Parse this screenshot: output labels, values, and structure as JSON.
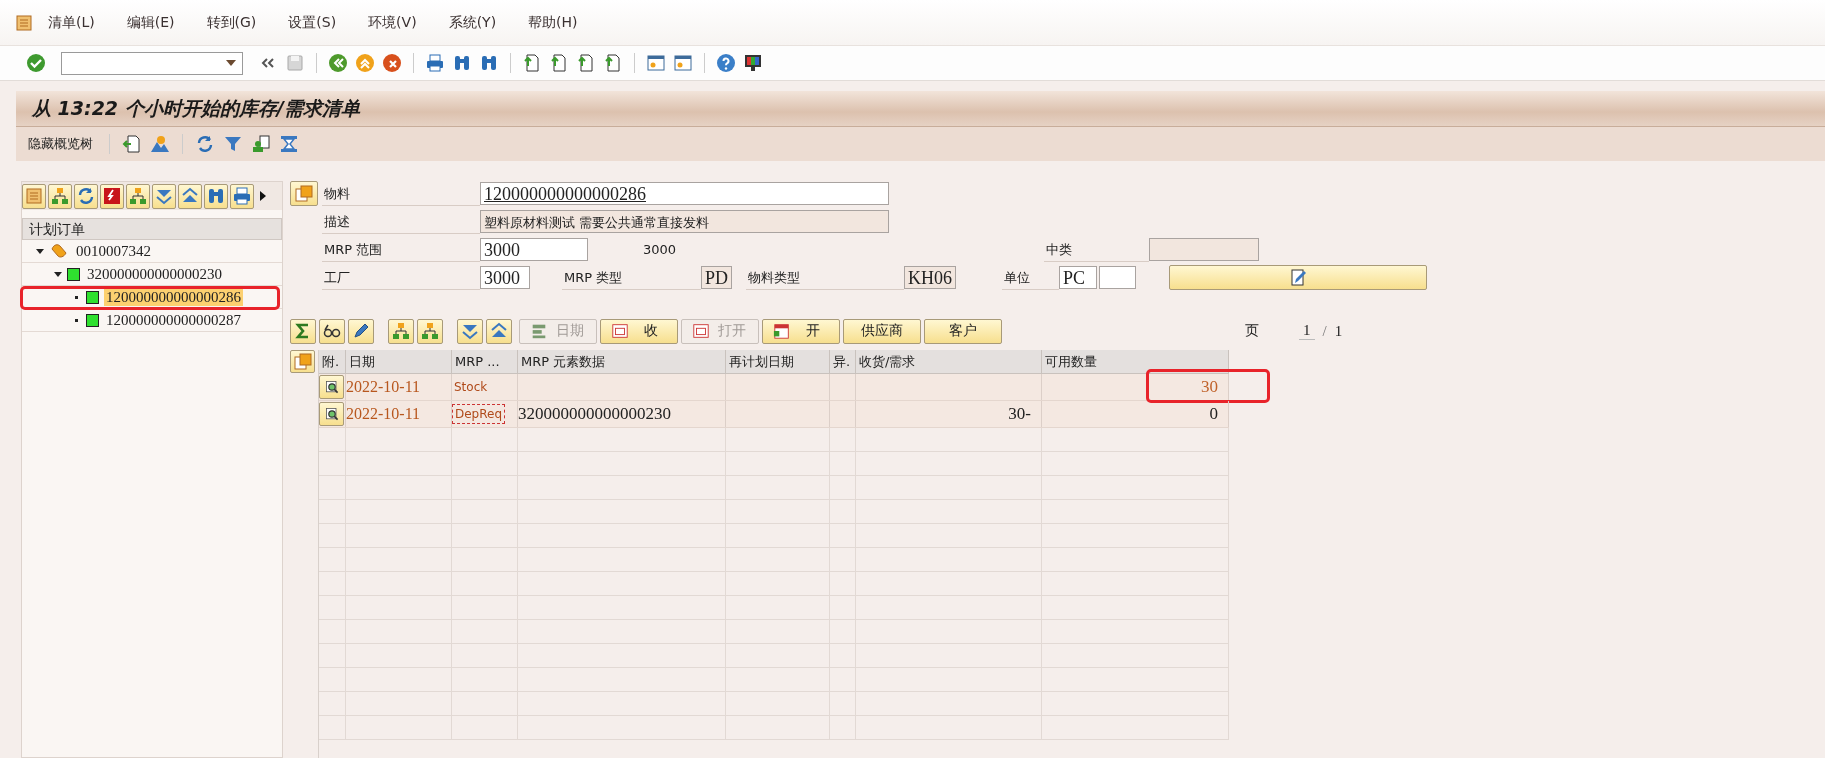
{
  "menu_bar": {
    "items": [
      "清单(L)",
      "编辑(E)",
      "转到(G)",
      "设置(S)",
      "环境(V)",
      "系统(Y)",
      "帮助(H)"
    ]
  },
  "title": "从 13:22 个小时开始的库存/需求清单",
  "hide_tree_button": "隐藏概览树",
  "tree": {
    "header": "计划订单",
    "items": [
      {
        "label": "0010007342",
        "kind": "folder",
        "expanded": true,
        "selected": false,
        "highlighted": false,
        "children": [
          {
            "label": "320000000000000230",
            "kind": "order",
            "expanded": true,
            "selected": false,
            "highlighted": false,
            "children": [
              {
                "label": "120000000000000286",
                "kind": "order",
                "selected": true,
                "highlighted": true
              },
              {
                "label": "120000000000000287",
                "kind": "order",
                "selected": false,
                "highlighted": false
              }
            ]
          }
        ]
      }
    ]
  },
  "header": {
    "material_label": "物料",
    "material": "120000000000000286",
    "description_label": "描述",
    "description": "塑料原材料测试  需要公共通常直接发料",
    "mrp_area_label": "MRP 范围",
    "mrp_area": "3000",
    "mrp_area_text": "3000",
    "middle_class_label": "中类",
    "plant_label": "工厂",
    "plant": "3000",
    "mrp_type_label": "MRP 类型",
    "mrp_type": "PD",
    "material_type_label": "物料类型",
    "material_type": "KH06",
    "unit_label": "单位",
    "unit": "PC"
  },
  "table_toolbar": {
    "buttons": [
      {
        "label": "日期",
        "kind": "date",
        "disabled": true
      },
      {
        "label": "收",
        "kind": "receipt",
        "disabled": false
      },
      {
        "label": "打开",
        "kind": "receipt",
        "disabled": true
      },
      {
        "label": "开",
        "kind": "calendar",
        "disabled": false
      },
      {
        "label": "供应商",
        "kind": "plain",
        "disabled": false
      },
      {
        "label": "客户",
        "kind": "plain",
        "disabled": false
      }
    ]
  },
  "pager": {
    "label": "页",
    "current": "1",
    "separator": "/",
    "total": "1"
  },
  "table": {
    "columns": [
      "附.",
      "日期",
      "MRP ...",
      "MRP 元素数据",
      "再计划日期",
      "异.",
      "收货/需求",
      "可用数量"
    ],
    "rows": [
      {
        "kind": "stock",
        "date": "2022-10-11",
        "element": "Stock",
        "available": "30",
        "highlighted": true,
        "focused": false
      },
      {
        "kind": "dependent",
        "date": "2022-10-11",
        "element": "DepReq",
        "element_data": "320000000000000230",
        "receipt": "30-",
        "available": "0",
        "highlighted": false,
        "focused": true
      }
    ]
  }
}
